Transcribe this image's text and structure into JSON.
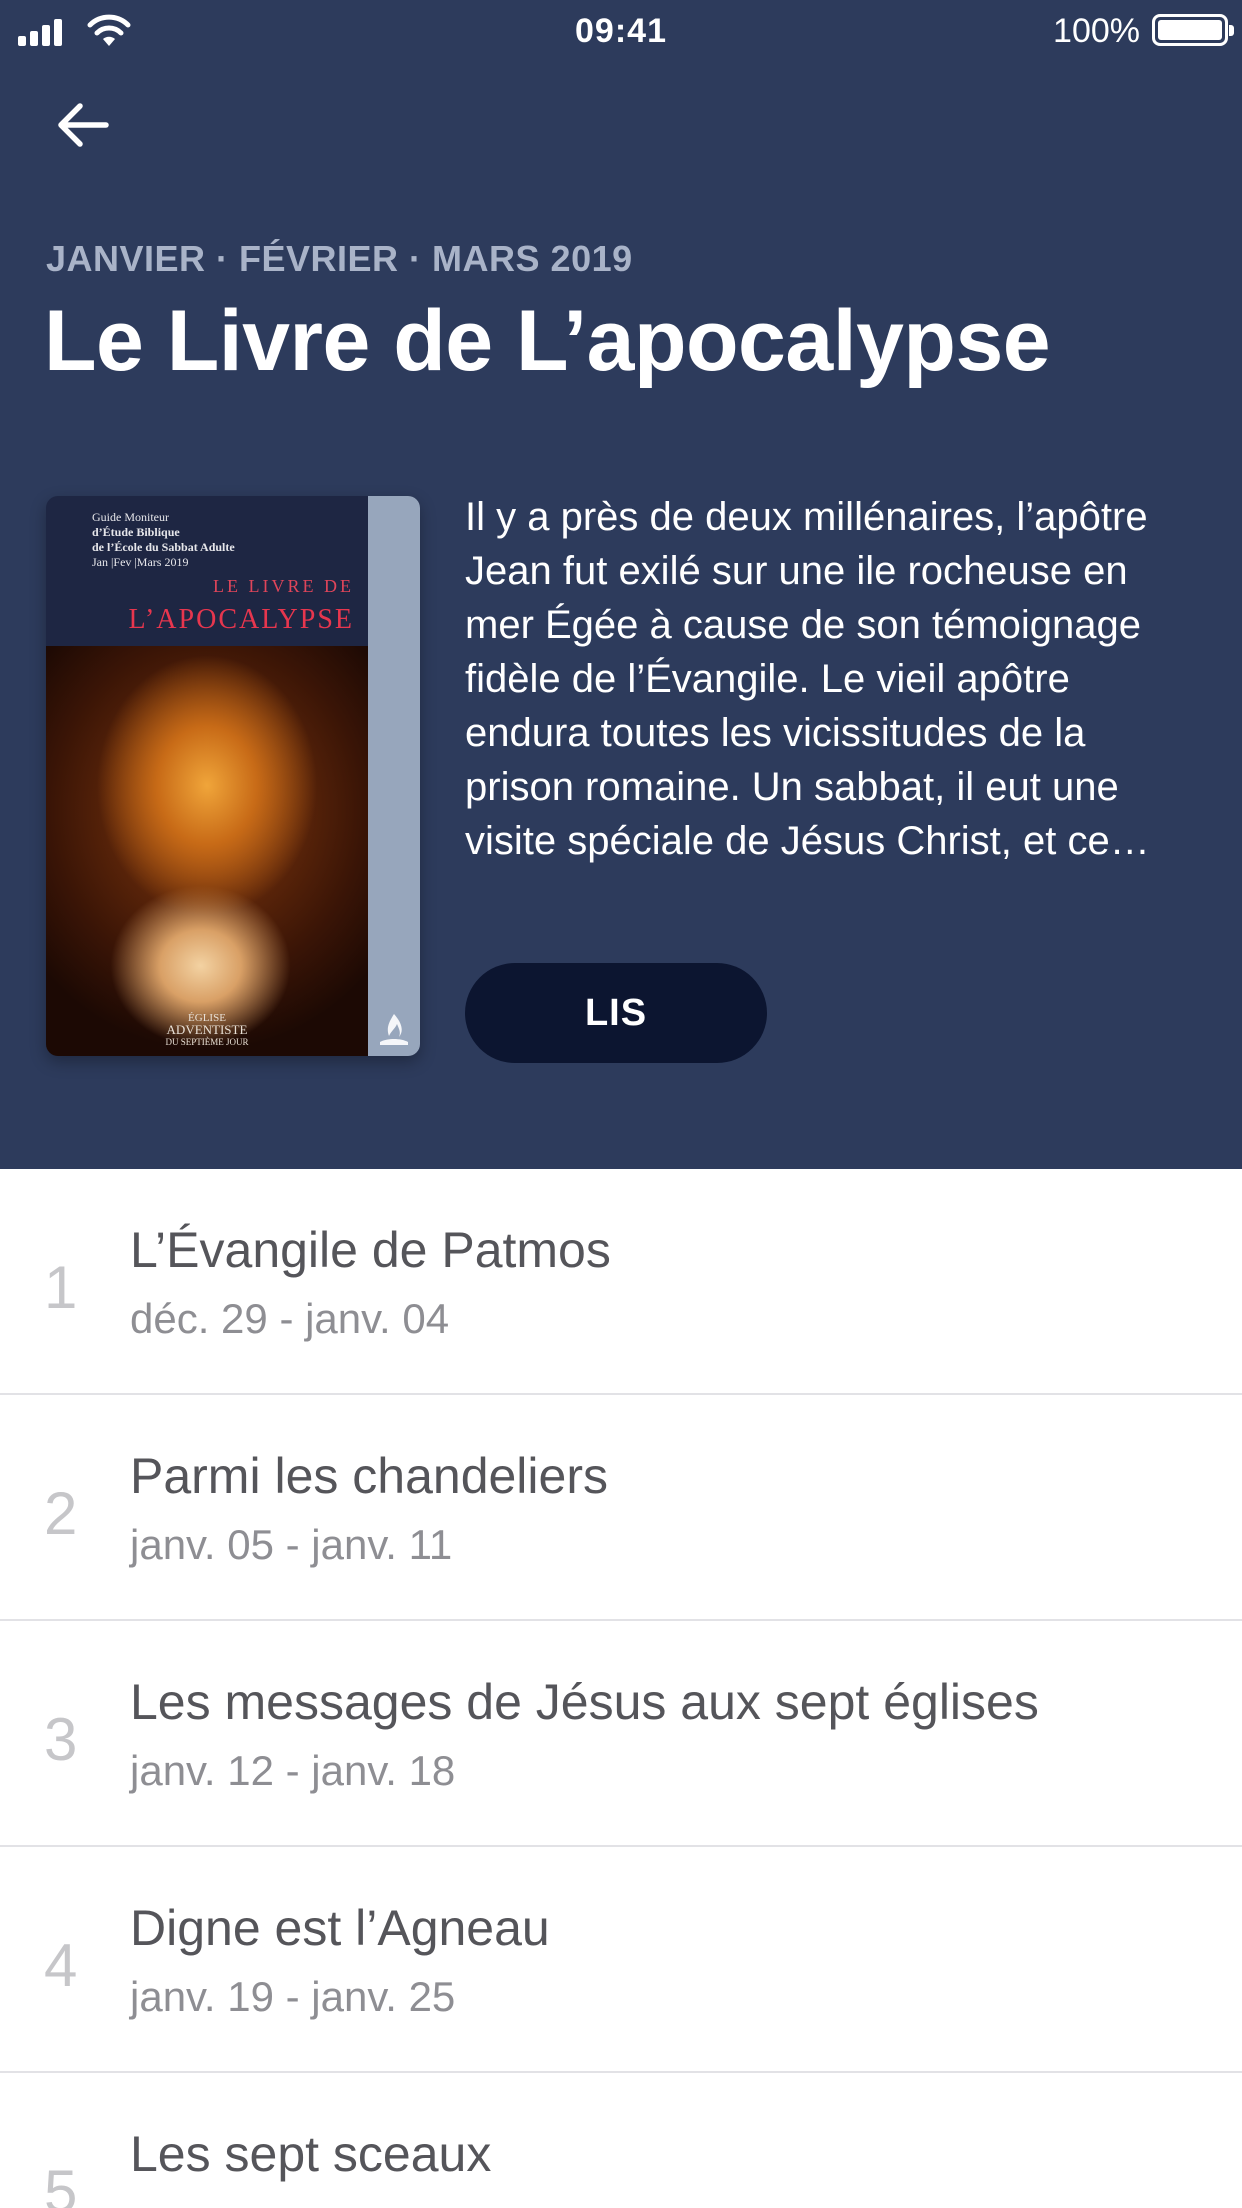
{
  "status_bar": {
    "time": "09:41",
    "battery": "100%"
  },
  "header": {
    "quarter": "JANVIER · FÉVRIER · MARS 2019",
    "title": "Le Livre de L’apocalypse",
    "description": "Il y a près de deux millénaires, l’apôtre Jean fut exilé sur une ile rocheuse en mer Égée à cause de son témoignage fidèle de l’Évangile. Le vieil apôtre endura toutes les vicissitudes de la prison romaine. Un sabbat, il eut une visite spéciale de Jésus Christ, et ce…",
    "read_button": "LIS",
    "colors": {
      "background": "#2d3b5c",
      "button": "#0c1530",
      "subtitle": "#a9b3c8"
    }
  },
  "cover": {
    "guide_line1": "Guide Moniteur",
    "guide_line2": "d’Étude Biblique",
    "guide_line3": "de l’École du Sabbat Adulte",
    "guide_line4": "Jan |Fev |Mars 2019",
    "book_line1": "LE LIVRE DE",
    "book_line2": "L’APOCALYPSE",
    "church_line1": "ÉGLISE",
    "church_line2": "ADVENTISTE",
    "church_line3": "DU SEPTIÈME JOUR"
  },
  "lessons": [
    {
      "number": "1",
      "title": "L’Évangile de Patmos",
      "dates": "déc. 29 - janv. 04"
    },
    {
      "number": "2",
      "title": "Parmi les chandeliers",
      "dates": "janv. 05 - janv. 11"
    },
    {
      "number": "3",
      "title": "Les messages de Jésus aux sept églises",
      "dates": "janv. 12 - janv. 18"
    },
    {
      "number": "4",
      "title": "Digne est l’Agneau",
      "dates": "janv. 19 - janv. 25"
    },
    {
      "number": "5",
      "title": "Les sept sceaux",
      "dates": ""
    }
  ],
  "icons": {
    "back": "arrow-left-icon",
    "signal": "cellular-signal-icon",
    "wifi": "wifi-icon",
    "battery": "battery-icon",
    "church_logo": "flame-logo-icon"
  }
}
